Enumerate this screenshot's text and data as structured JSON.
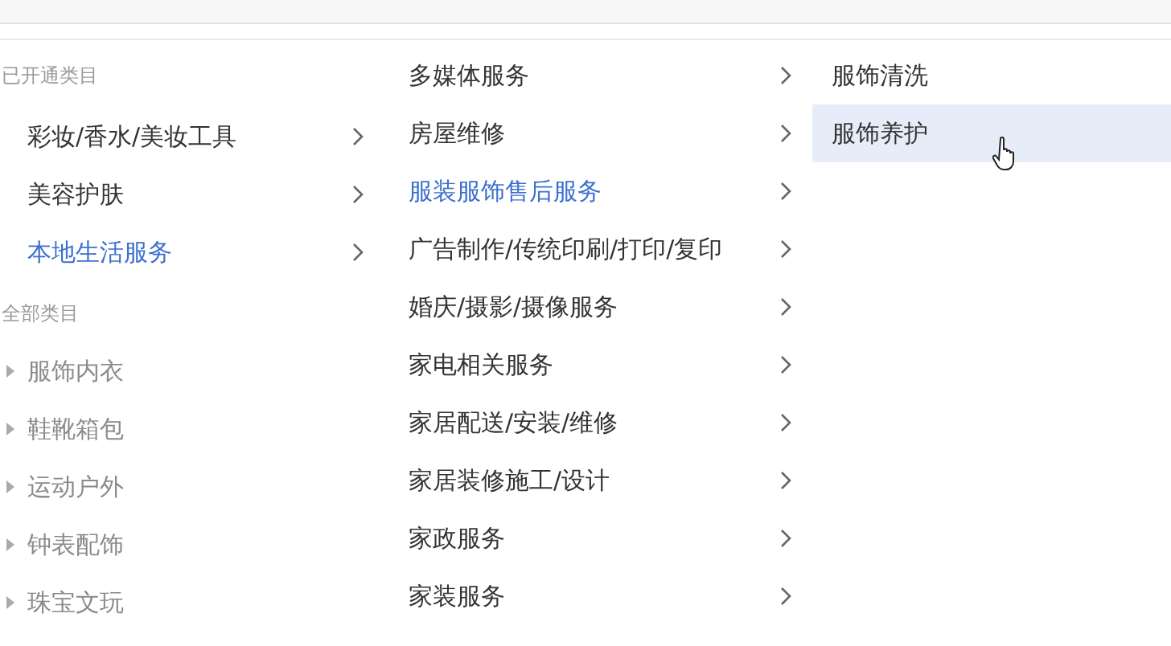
{
  "opened_categories": {
    "heading": "已开通类目",
    "items": [
      {
        "label": "彩妆/香水/美妆工具",
        "selected": false
      },
      {
        "label": "美容护肤",
        "selected": false
      },
      {
        "label": "本地生活服务",
        "selected": true
      }
    ]
  },
  "all_categories": {
    "heading": "全部类目",
    "items": [
      {
        "label": "服饰内衣"
      },
      {
        "label": "鞋靴箱包"
      },
      {
        "label": "运动户外"
      },
      {
        "label": "钟表配饰"
      },
      {
        "label": "珠宝文玩"
      }
    ]
  },
  "subcategories": [
    {
      "label": "多媒体服务",
      "selected": false
    },
    {
      "label": "房屋维修",
      "selected": false
    },
    {
      "label": "服装服饰售后服务",
      "selected": true
    },
    {
      "label": "广告制作/传统印刷/打印/复印",
      "selected": false
    },
    {
      "label": "婚庆/摄影/摄像服务",
      "selected": false
    },
    {
      "label": "家电相关服务",
      "selected": false
    },
    {
      "label": "家居配送/安装/维修",
      "selected": false
    },
    {
      "label": "家居装修施工/设计",
      "selected": false
    },
    {
      "label": "家政服务",
      "selected": false
    },
    {
      "label": "家装服务",
      "selected": false
    }
  ],
  "services": [
    {
      "label": "服饰清洗",
      "selected": false
    },
    {
      "label": "服饰养护",
      "selected": true
    }
  ]
}
